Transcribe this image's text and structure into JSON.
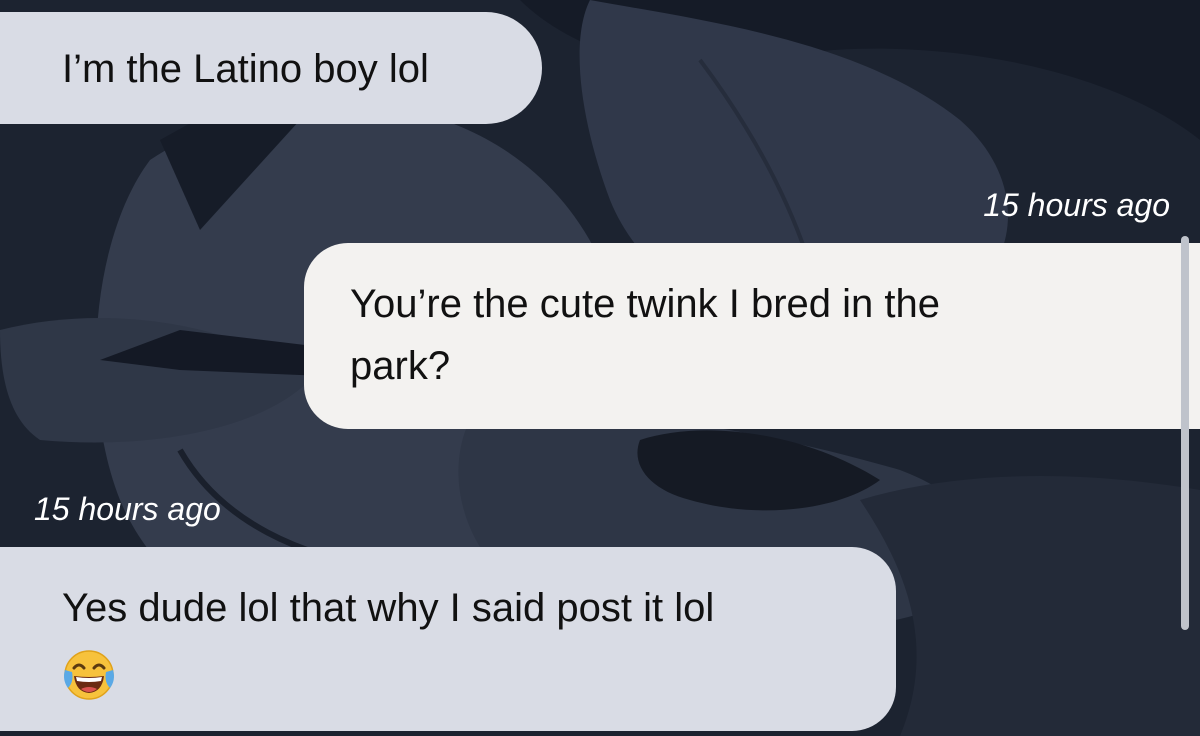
{
  "messages": [
    {
      "direction": "incoming",
      "lines": [
        "I’m the Latino boy lol"
      ]
    },
    {
      "direction": "outgoing",
      "timestamp": "15 hours ago",
      "lines": [
        "You’re the cute twink I bred in the",
        "park?"
      ]
    },
    {
      "direction": "incoming",
      "timestamp": "15 hours ago",
      "lines": [
        "Yes dude lol that why I said post it lol"
      ],
      "emoji": "face-with-tears-of-joy-icon"
    }
  ],
  "colors": {
    "background": "#1c2330",
    "incoming_bubble": "#d9dce5",
    "outgoing_bubble": "#f3f2f0",
    "timestamp_text": "#ffffff",
    "message_text": "#111111"
  }
}
